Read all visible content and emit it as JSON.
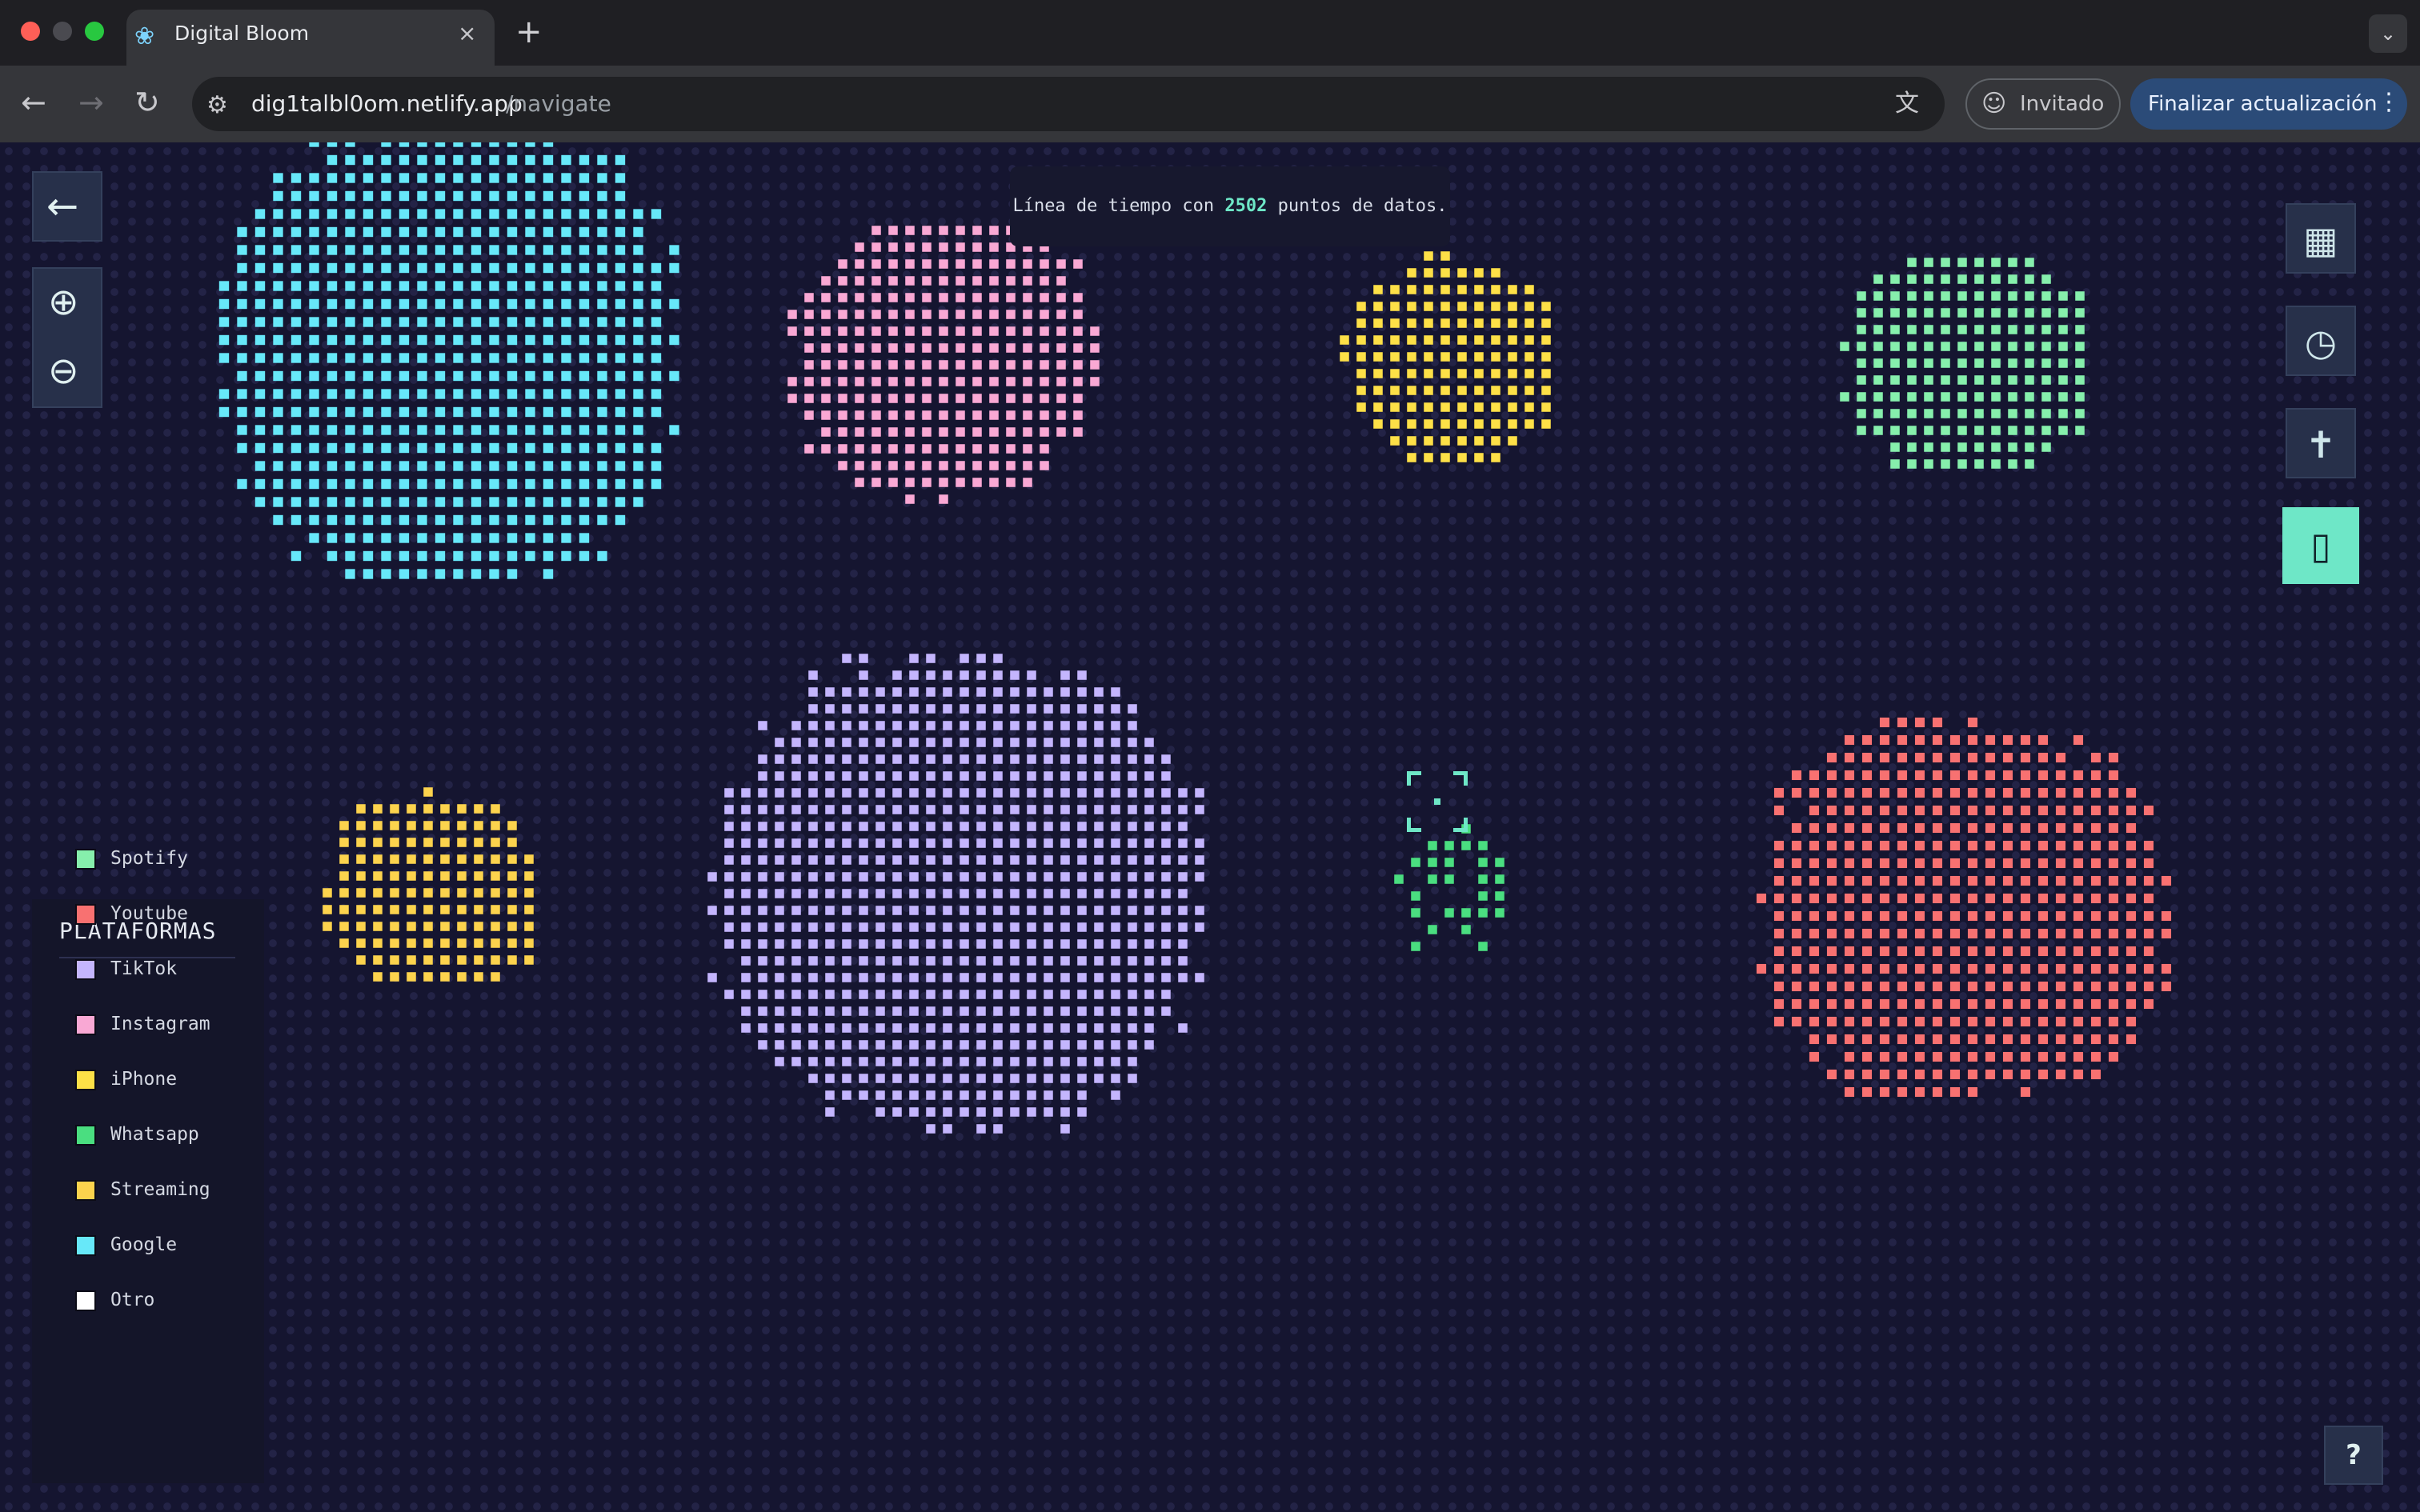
{
  "browser": {
    "tab_title": "Digital Bloom",
    "tab_favicon": "flower-icon",
    "tab_close": "×",
    "new_tab": "+",
    "tab_menu": "⌄",
    "nav_back": "←",
    "nav_forward": "→",
    "nav_reload": "↻",
    "url_host": "dig1talbl0om.netlify.app",
    "url_path": "/navigate",
    "profile_label": "Invitado",
    "update_label": "Finalizar actualización",
    "update_more": "⋮"
  },
  "app": {
    "back_icon": "←",
    "zoom_in_icon": "⊕",
    "zoom_out_icon": "⊖",
    "info": {
      "prefix": "Línea de tiempo con",
      "count": "2502",
      "suffix": "puntos de datos."
    },
    "views": [
      {
        "name": "grid-icon",
        "glyph": "▦"
      },
      {
        "name": "clock-icon",
        "glyph": "◷"
      },
      {
        "name": "person-icon",
        "glyph": "✝"
      },
      {
        "name": "phone-icon",
        "glyph": "▯"
      }
    ],
    "active_view": "phone-icon",
    "legend": {
      "title": "PLATAFORMAS",
      "items": [
        {
          "label": "Spotify",
          "color": "#86efac"
        },
        {
          "label": "Youtube",
          "color": "#f87171"
        },
        {
          "label": "TikTok",
          "color": "#c4b5fd"
        },
        {
          "label": "Instagram",
          "color": "#f9a8d4"
        },
        {
          "label": "iPhone",
          "color": "#fde047"
        },
        {
          "label": "Whatsapp",
          "color": "#4ade80"
        },
        {
          "label": "Streaming",
          "color": "#fcd34d"
        },
        {
          "label": "Google",
          "color": "#67e8f9"
        },
        {
          "label": "Otro",
          "color": "#ffffff"
        }
      ]
    },
    "help_label": "?",
    "clusters": [
      {
        "platform": "Google",
        "color": "#67e8f9",
        "points": 620
      },
      {
        "platform": "Instagram",
        "color": "#f9a8d4",
        "points": 290
      },
      {
        "platform": "iPhone",
        "color": "#fde047",
        "points": 170
      },
      {
        "platform": "Spotify",
        "color": "#86efac",
        "points": 180
      },
      {
        "platform": "Streaming",
        "color": "#fcd34d",
        "points": 110
      },
      {
        "platform": "TikTok",
        "color": "#c4b5fd",
        "points": 680
      },
      {
        "platform": "Whatsapp",
        "color": "#4ade80",
        "points": 18
      },
      {
        "platform": "Youtube",
        "color": "#f87171",
        "points": 500
      }
    ]
  }
}
